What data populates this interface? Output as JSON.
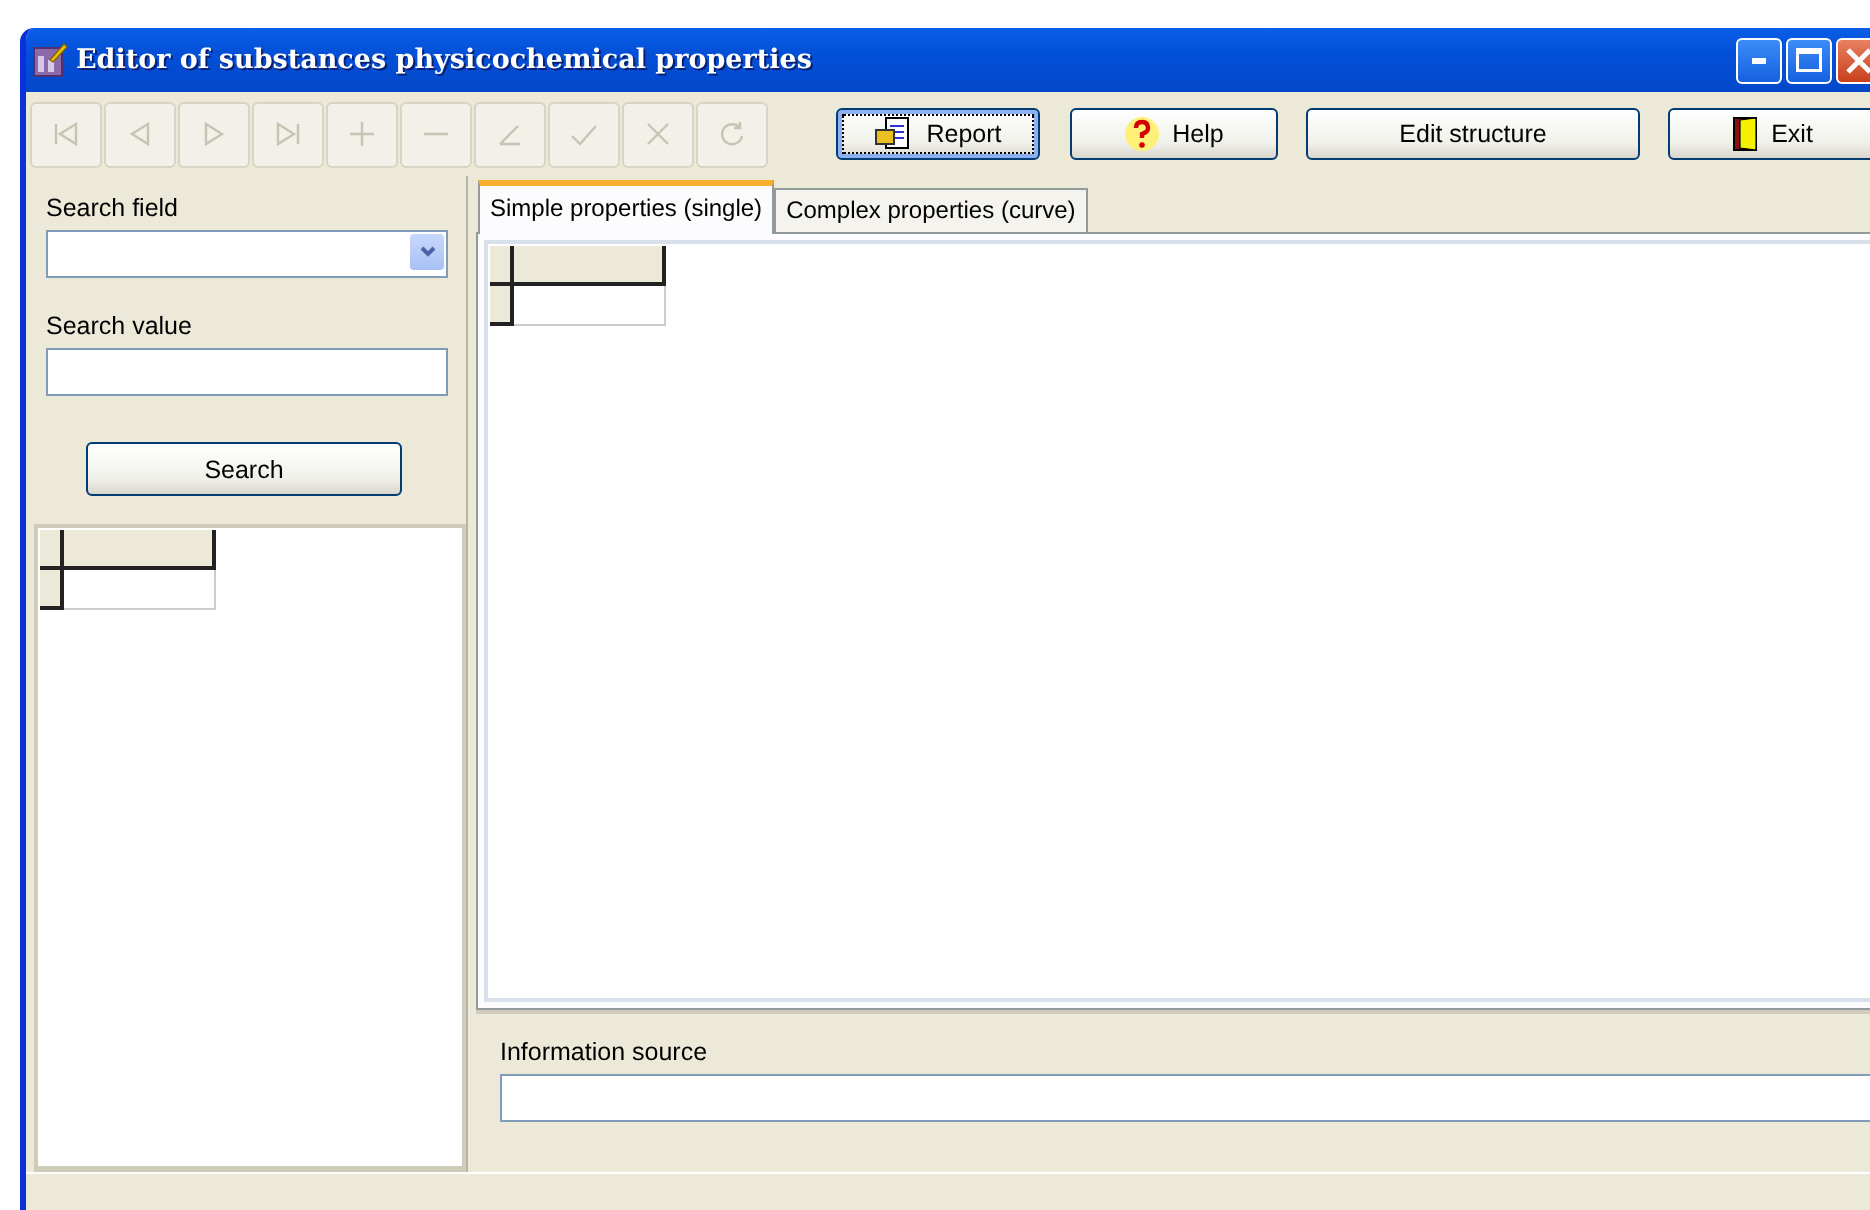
{
  "window": {
    "title": "Editor of substances physicochemical properties"
  },
  "navigator": [
    {
      "kind": "first",
      "disabled": true
    },
    {
      "kind": "prior",
      "disabled": true
    },
    {
      "kind": "next",
      "disabled": true
    },
    {
      "kind": "last",
      "disabled": true
    },
    {
      "kind": "insert",
      "disabled": true
    },
    {
      "kind": "delete",
      "disabled": true
    },
    {
      "kind": "edit",
      "disabled": true
    },
    {
      "kind": "post",
      "disabled": true
    },
    {
      "kind": "cancel",
      "disabled": true
    },
    {
      "kind": "refresh",
      "disabled": true
    }
  ],
  "buttons": [
    {
      "label": "Report",
      "kind": "report",
      "focused": true
    },
    {
      "label": "Help",
      "kind": "help",
      "focused": false
    },
    {
      "label": "Edit structure",
      "kind": "plain",
      "focused": false
    },
    {
      "label": "Exit",
      "kind": "exit",
      "focused": false
    }
  ],
  "search": {
    "field_label": "Search field",
    "value_label": "Search value",
    "button": "Search"
  },
  "tabs": [
    {
      "label": "Simple properties (single)",
      "selected": true
    },
    {
      "label": "Complex properties (curve)",
      "selected": false
    }
  ],
  "source": {
    "label": "Information source"
  }
}
